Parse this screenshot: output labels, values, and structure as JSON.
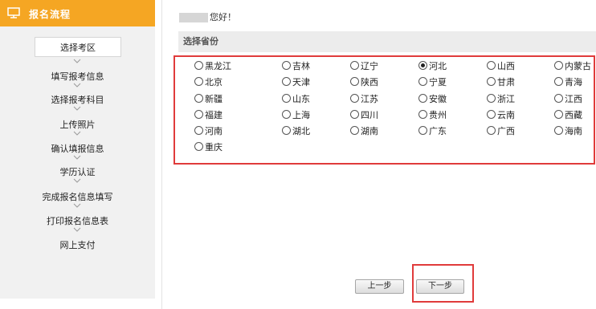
{
  "sidebar": {
    "title": "报名流程",
    "steps": [
      "选择考区",
      "填写报考信息",
      "选择报考科目",
      "上传照片",
      "确认填报信息",
      "学历认证",
      "完成报名信息填写",
      "打印报名信息表",
      "网上支付"
    ],
    "active_index": 0
  },
  "main": {
    "greeting": "您好！",
    "section_title": "选择省份",
    "selected": "河北",
    "provinces": [
      [
        "黑龙江",
        "吉林",
        "辽宁",
        "河北",
        "山西",
        "内蒙古"
      ],
      [
        "北京",
        "天津",
        "陕西",
        "宁夏",
        "甘肃",
        "青海"
      ],
      [
        "新疆",
        "山东",
        "江苏",
        "安徽",
        "浙江",
        "江西"
      ],
      [
        "福建",
        "上海",
        "四川",
        "贵州",
        "云南",
        "西藏"
      ],
      [
        "河南",
        "湖北",
        "湖南",
        "广东",
        "广西",
        "海南"
      ],
      [
        "重庆"
      ]
    ],
    "prev_label": "上一步",
    "next_label": "下一步"
  },
  "colors": {
    "accent": "#f5a623",
    "highlight": "#e03b3b"
  }
}
